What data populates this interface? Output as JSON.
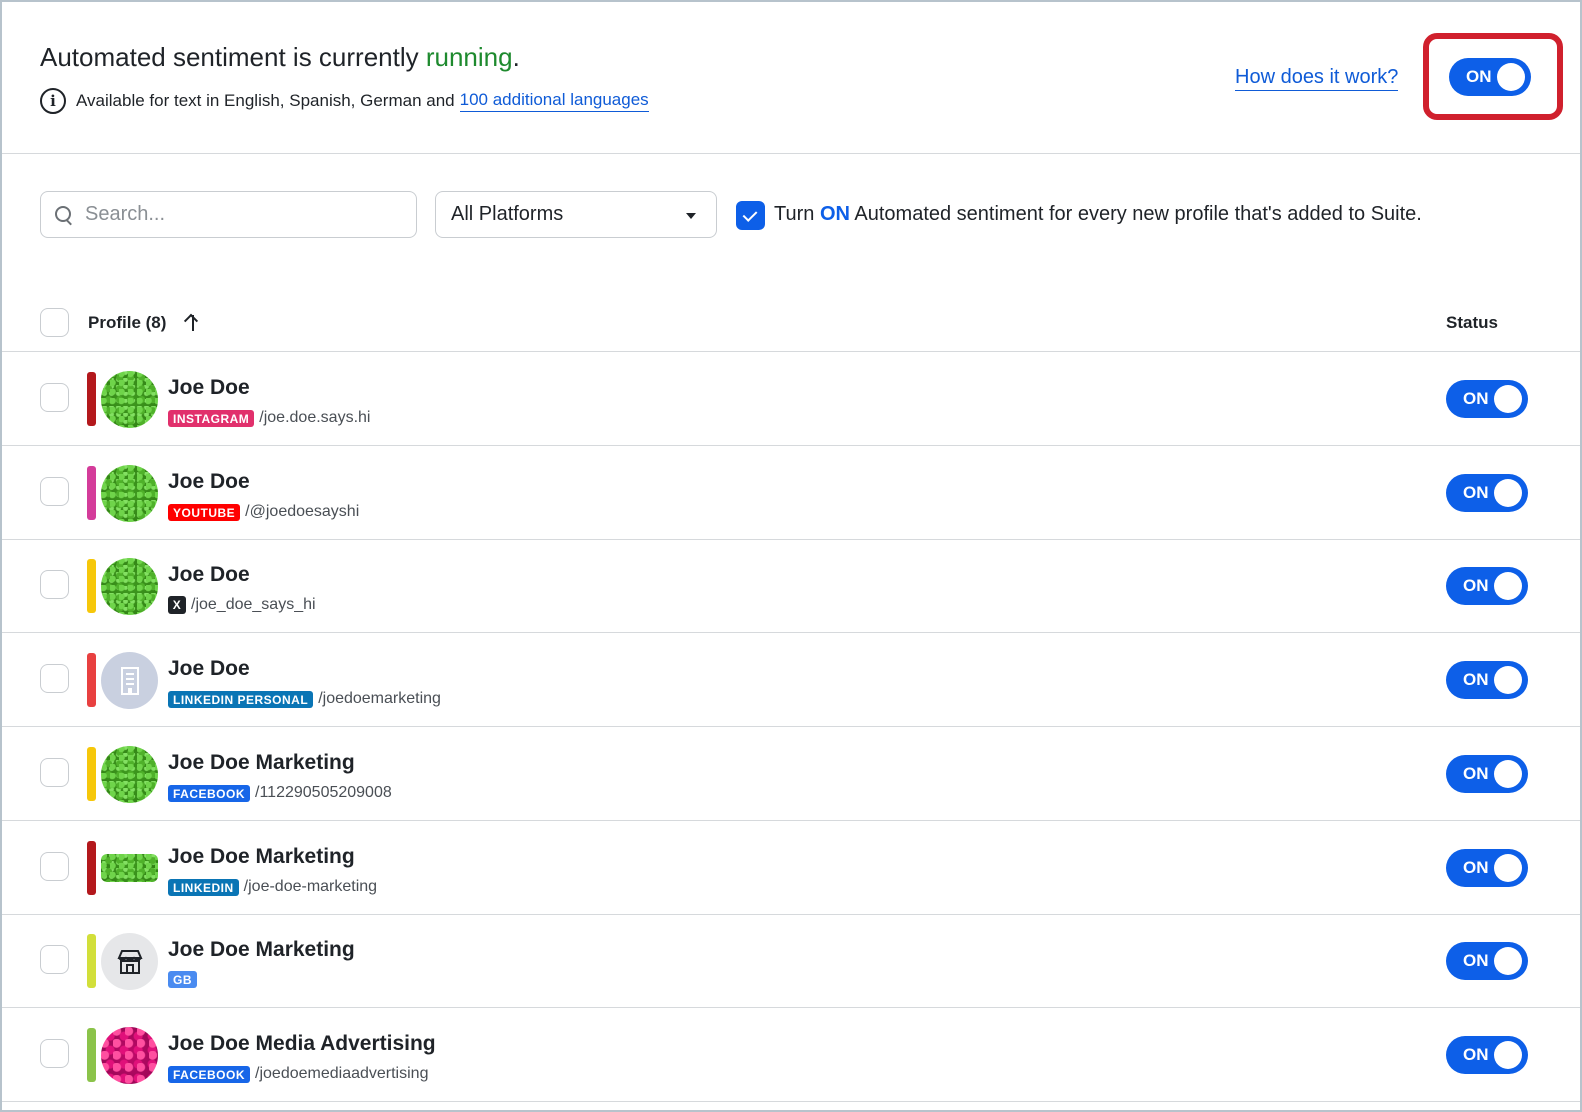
{
  "header": {
    "title_prefix": "Automated sentiment is currently ",
    "title_status": "running",
    "title_suffix": ".",
    "info_text": "Available for text in English, Spanish, German and",
    "info_link": "100 additional languages",
    "how_link": "How does it work?",
    "main_toggle": "ON"
  },
  "filters": {
    "search_placeholder": "Search...",
    "platform_select": "All Platforms",
    "auto_text_pre": "Turn ",
    "auto_text_on": "ON",
    "auto_text_post": " Automated sentiment for every new profile that's added to Suite."
  },
  "table": {
    "profile_header": "Profile (8)",
    "status_header": "Status",
    "rows": [
      {
        "name": "Joe Doe",
        "badge": "INSTAGRAM",
        "badge_color": "#e1306c",
        "handle": "/joe.doe.says.hi",
        "bar_color": "#b3181c",
        "avatar": "leaf",
        "status": "ON"
      },
      {
        "name": "Joe Doe",
        "badge": "YOUTUBE",
        "badge_color": "#ff0000",
        "handle": "/@joedoesayshi",
        "bar_color": "#d43c9a",
        "avatar": "leaf",
        "status": "ON"
      },
      {
        "name": "Joe Doe",
        "badge": "X",
        "badge_color": "#1f2328",
        "handle": "/joe_doe_says_hi",
        "bar_color": "#f6c70a",
        "avatar": "leaf",
        "status": "ON"
      },
      {
        "name": "Joe Doe",
        "badge": "LINKEDIN PERSONAL",
        "badge_color": "#0a75b5",
        "handle": "/joedoemarketing",
        "bar_color": "#e84040",
        "avatar": "building",
        "status": "ON"
      },
      {
        "name": "Joe Doe Marketing",
        "badge": "FACEBOOK",
        "badge_color": "#1766e8",
        "handle": "/112290505209008",
        "bar_color": "#f6c70a",
        "avatar": "leaf",
        "status": "ON"
      },
      {
        "name": "Joe Doe Marketing",
        "badge": "LINKEDIN",
        "badge_color": "#0a75b5",
        "handle": "/joe-doe-marketing",
        "bar_color": "#b3181c",
        "avatar": "cover",
        "status": "ON"
      },
      {
        "name": "Joe Doe Marketing",
        "badge": "GB",
        "badge_color": "#4a8bf0",
        "handle": "",
        "bar_color": "#d2df3a",
        "avatar": "store",
        "status": "ON"
      },
      {
        "name": "Joe Doe Media Advertising",
        "badge": "FACEBOOK",
        "badge_color": "#1766e8",
        "handle": "/joedoemediaadvertising",
        "bar_color": "#8bc34a",
        "avatar": "rose",
        "status": "ON"
      }
    ]
  }
}
